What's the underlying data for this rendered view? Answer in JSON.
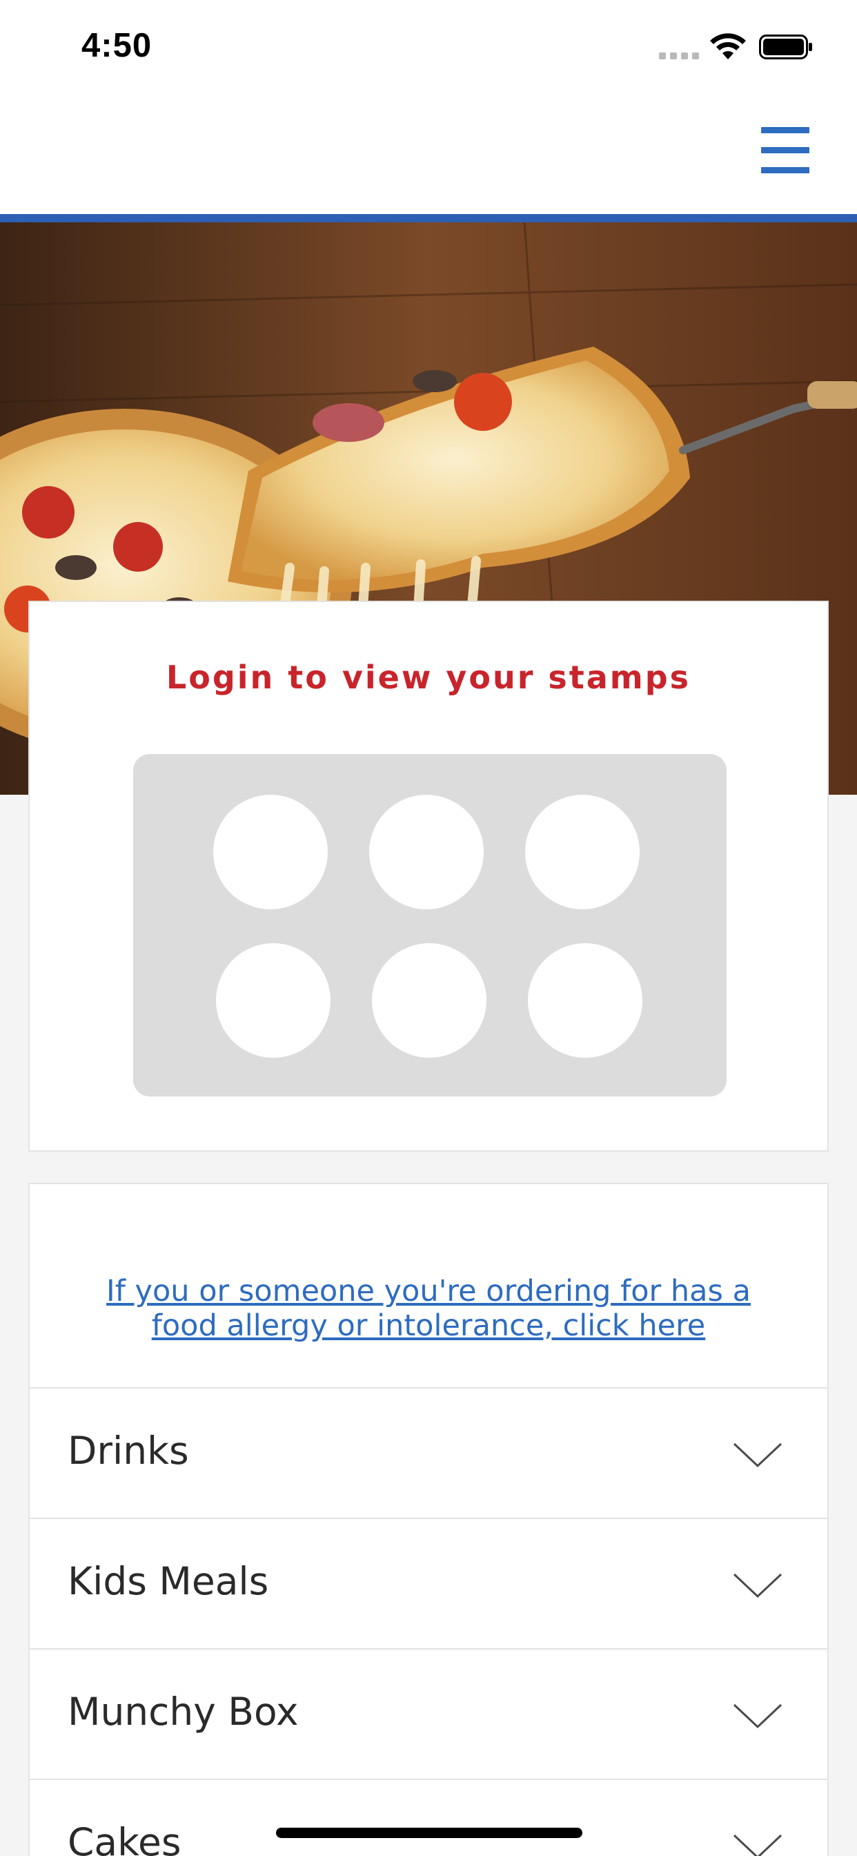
{
  "status_bar": {
    "time": "4:50"
  },
  "header": {
    "menu_icon": "hamburger-icon",
    "accent_color": "#2d6cc0"
  },
  "hero": {
    "image": "pizza-slice-photo"
  },
  "stamps": {
    "title": "Login to view your stamps",
    "count": 6,
    "title_color": "#c9242b"
  },
  "menu": {
    "allergy_link": "If you or someone you're ordering for has a food allergy or intolerance, click here",
    "categories": [
      {
        "label": "Drinks"
      },
      {
        "label": "Kids Meals"
      },
      {
        "label": "Munchy Box"
      },
      {
        "label": "Cakes"
      }
    ]
  }
}
